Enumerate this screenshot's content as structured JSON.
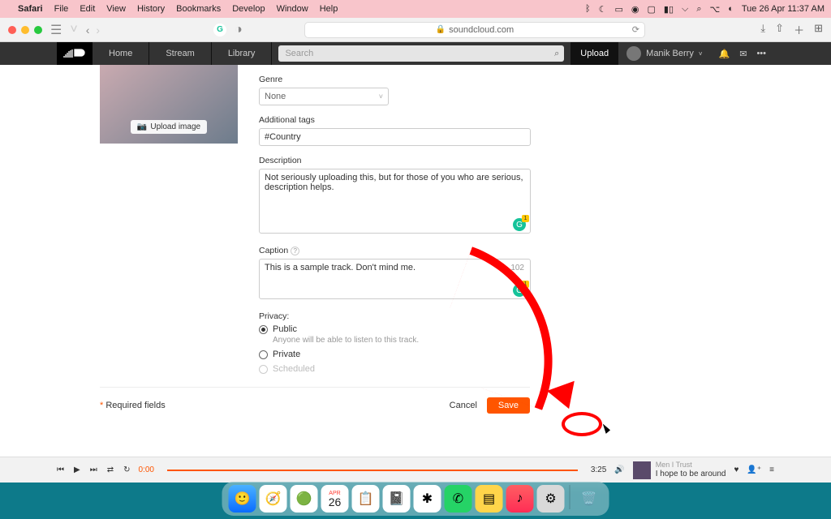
{
  "menubar": {
    "app": "Safari",
    "items": [
      "File",
      "Edit",
      "View",
      "History",
      "Bookmarks",
      "Develop",
      "Window",
      "Help"
    ],
    "clock": "Tue 26 Apr 11:37 AM"
  },
  "safari": {
    "url_display": "soundcloud.com"
  },
  "scnav": {
    "links": [
      "Home",
      "Stream",
      "Library"
    ],
    "search_placeholder": "Search",
    "upload": "Upload",
    "username": "Manik Berry"
  },
  "form": {
    "upload_image": "Upload image",
    "genre_label": "Genre",
    "genre_value": "None",
    "tags_label": "Additional tags",
    "tags_value": "#Country",
    "desc_label": "Description",
    "desc_value": "Not seriously uploading this, but for those of you who are serious, description helps.",
    "caption_label": "Caption",
    "caption_value": "This is a sample track. Don't mind me.",
    "caption_remaining": "102",
    "privacy_label": "Privacy:",
    "public": "Public",
    "public_sub": "Anyone will be able to listen to this track.",
    "private": "Private",
    "scheduled": "Scheduled",
    "required": "Required fields",
    "cancel": "Cancel",
    "save": "Save"
  },
  "player": {
    "current": "0:00",
    "duration": "3:25",
    "artist": "Men I Trust",
    "title": "I hope to be around"
  },
  "dock": {
    "date_month": "APR",
    "date_day": "26"
  }
}
